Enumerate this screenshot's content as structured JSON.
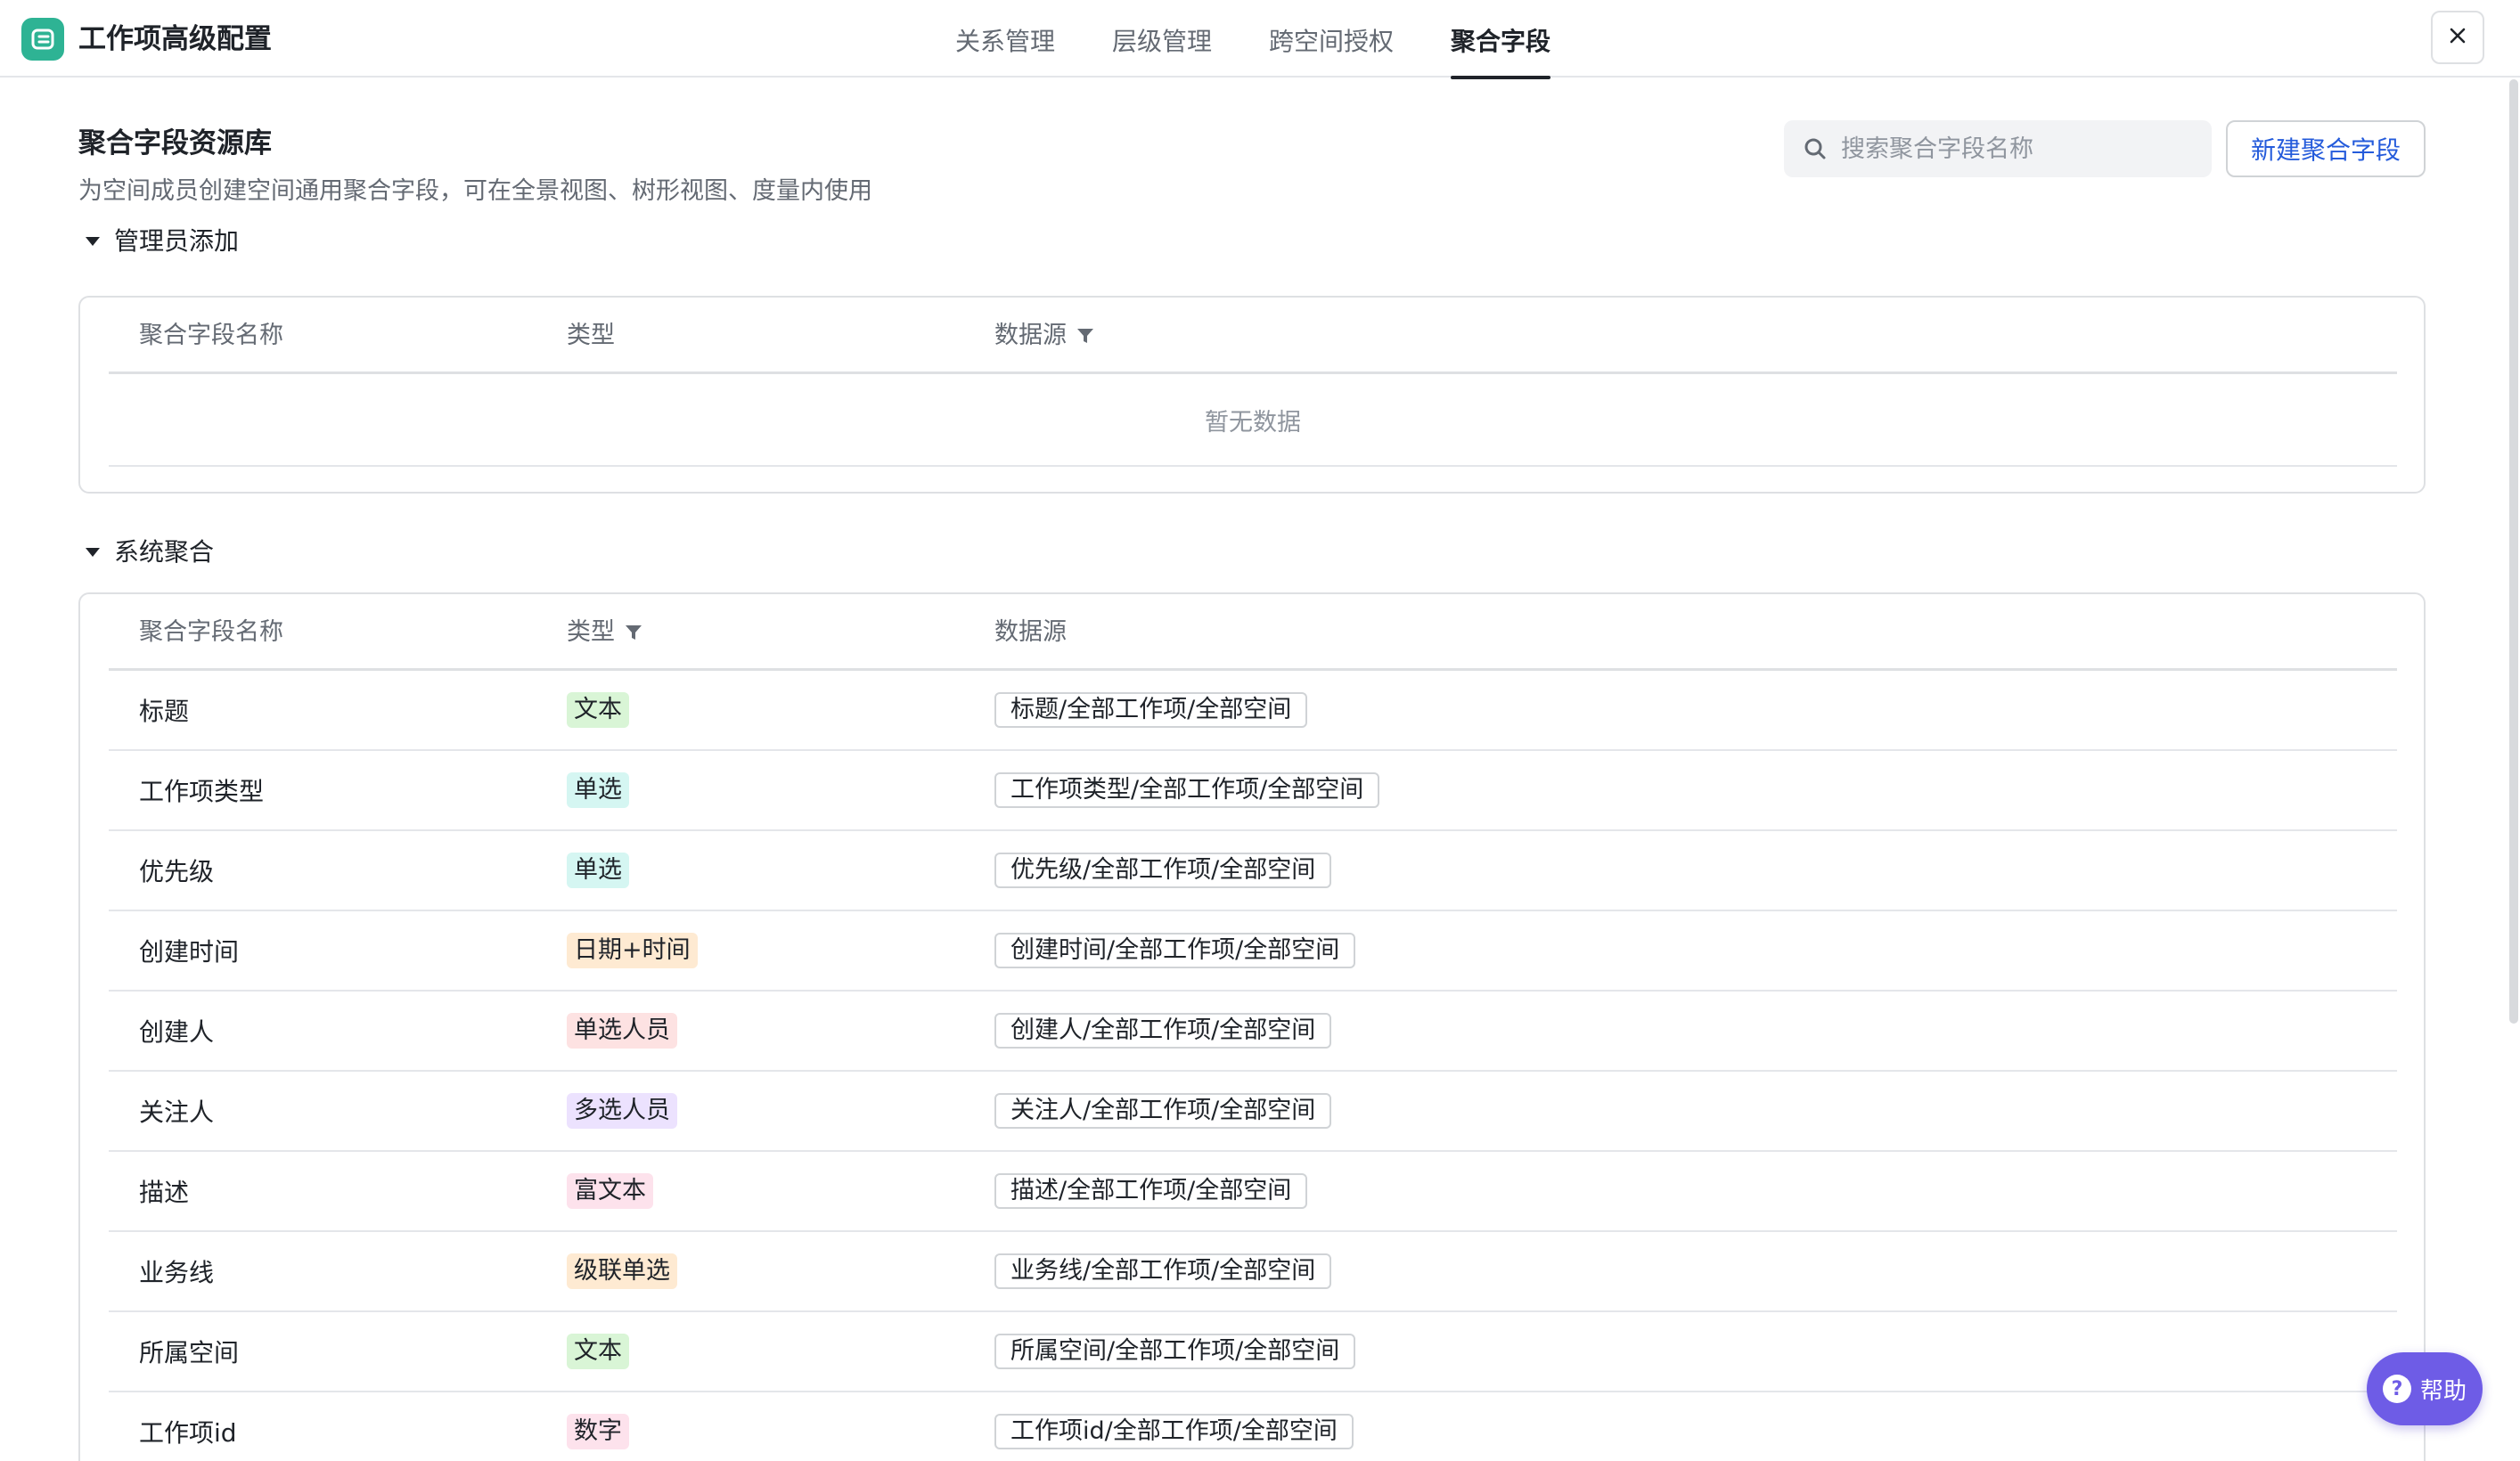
{
  "header": {
    "title": "工作项高级配置",
    "tabs": [
      {
        "label": "关系管理",
        "active": false
      },
      {
        "label": "层级管理",
        "active": false
      },
      {
        "label": "跨空间授权",
        "active": false
      },
      {
        "label": "聚合字段",
        "active": true
      }
    ],
    "close_icon": "close-icon",
    "logo_icon": "app-logo-icon"
  },
  "library": {
    "title": "聚合字段资源库",
    "description": "为空间成员创建空间通用聚合字段，可在全景视图、树形视图、度量内使用",
    "search": {
      "placeholder": "搜索聚合字段名称",
      "value": ""
    },
    "new_button": "新建聚合字段"
  },
  "admin_section": {
    "title": "管理员添加",
    "expanded": true,
    "columns": [
      "聚合字段名称",
      "类型",
      "数据源"
    ],
    "empty_text": "暂无数据"
  },
  "system_section": {
    "title": "系统聚合",
    "expanded": true,
    "columns": [
      "聚合字段名称",
      "类型",
      "数据源"
    ],
    "rows": [
      {
        "name": "标题",
        "type": "文本",
        "type_color": "#d9f5d6",
        "source": "标题/全部工作项/全部空间"
      },
      {
        "name": "工作项类型",
        "type": "单选",
        "type_color": "#d5f6f2",
        "source": "工作项类型/全部工作项/全部空间"
      },
      {
        "name": "优先级",
        "type": "单选",
        "type_color": "#d5f6f2",
        "source": "优先级/全部工作项/全部空间"
      },
      {
        "name": "创建时间",
        "type": "日期+时间",
        "type_color": "#feead2",
        "source": "创建时间/全部工作项/全部空间"
      },
      {
        "name": "创建人",
        "type": "单选人员",
        "type_color": "#fde2e2",
        "source": "创建人/全部工作项/全部空间"
      },
      {
        "name": "关注人",
        "type": "多选人员",
        "type_color": "#ece2fe",
        "source": "关注人/全部工作项/全部空间"
      },
      {
        "name": "描述",
        "type": "富文本",
        "type_color": "#fde2ec",
        "source": "描述/全部工作项/全部空间"
      },
      {
        "name": "业务线",
        "type": "级联单选",
        "type_color": "#feead2",
        "source": "业务线/全部工作项/全部空间"
      },
      {
        "name": "所属空间",
        "type": "文本",
        "type_color": "#d9f5d6",
        "source": "所属空间/全部工作项/全部空间"
      },
      {
        "name": "工作项id",
        "type": "数字",
        "type_color": "#fde2ec",
        "source": "工作项id/全部工作项/全部空间"
      }
    ]
  },
  "help_button": {
    "label": "帮助"
  },
  "colors": {
    "accent": "#245bdb",
    "brand": "#2eb394",
    "help": "#6e5ce6"
  }
}
